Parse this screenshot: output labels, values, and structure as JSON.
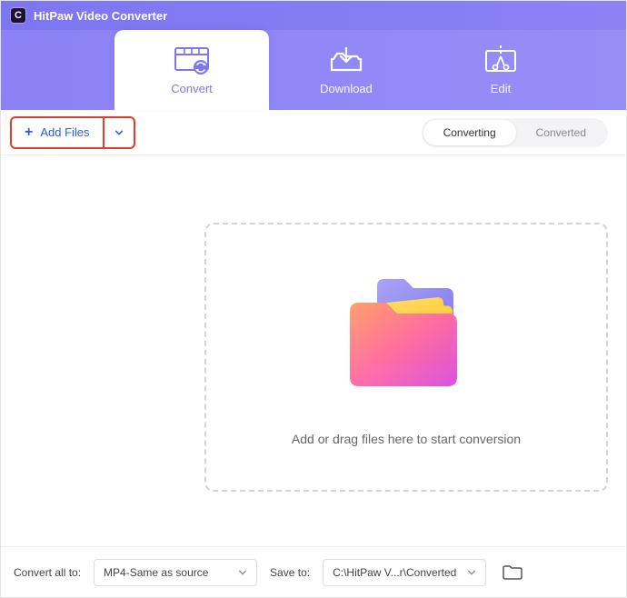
{
  "titlebar": {
    "app_name": "HitPaw Video Converter"
  },
  "tabs": {
    "convert": "Convert",
    "download": "Download",
    "edit": "Edit"
  },
  "toolbar": {
    "add_files_label": "Add Files"
  },
  "segment": {
    "converting": "Converting",
    "converted": "Converted"
  },
  "dropzone": {
    "hint": "Add or drag files here to start conversion"
  },
  "bottombar": {
    "convert_all_to_label": "Convert all to:",
    "format_value": "MP4-Same as source",
    "save_to_label": "Save to:",
    "save_path_value": "C:\\HitPaw V...r\\Converted"
  },
  "colors": {
    "primary": "#8a82f5",
    "highlight_red": "#e33b2e",
    "link_blue": "#2a5be8"
  }
}
